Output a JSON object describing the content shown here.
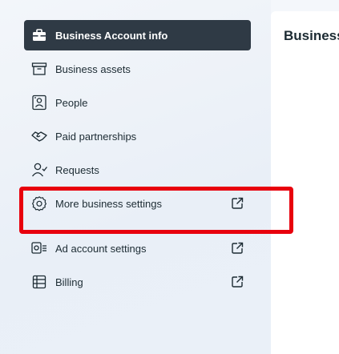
{
  "sidebar": {
    "items": [
      {
        "label": "Business Account info",
        "icon": "briefcase-icon",
        "active": true,
        "external": false
      },
      {
        "label": "Business assets",
        "icon": "archive-box-icon",
        "active": false,
        "external": false
      },
      {
        "label": "People",
        "icon": "people-id-icon",
        "active": false,
        "external": false
      },
      {
        "label": "Paid partnerships",
        "icon": "handshake-icon",
        "active": false,
        "external": false
      },
      {
        "label": "Requests",
        "icon": "person-add-icon",
        "active": false,
        "external": false
      },
      {
        "label": "More business settings",
        "icon": "gear-icon",
        "active": false,
        "external": true
      },
      {
        "label": "Ad account settings",
        "icon": "ad-account-icon",
        "active": false,
        "external": true
      },
      {
        "label": "Billing",
        "icon": "billing-icon",
        "active": false,
        "external": true
      }
    ]
  },
  "main": {
    "title": "Business"
  },
  "annotation": {
    "color": "#e8000d"
  },
  "colors": {
    "active_bg": "#2f3a45",
    "text": "#1c2b33"
  }
}
